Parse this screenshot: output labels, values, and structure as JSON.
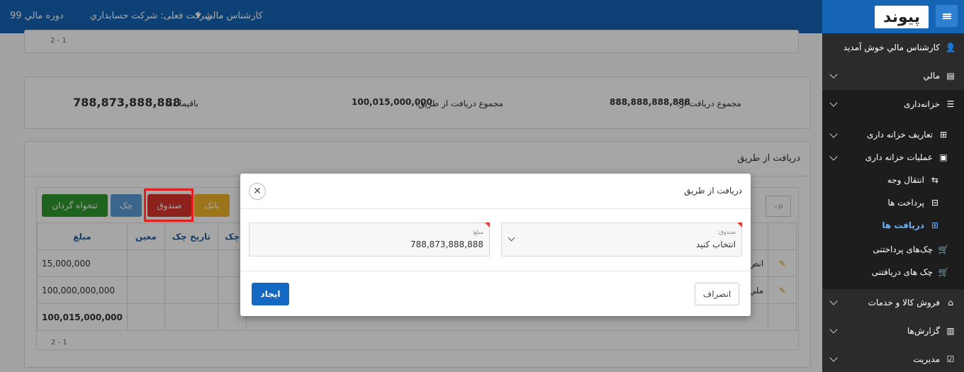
{
  "topbar": {
    "fiscal_period": "دوره مالي 99",
    "company": "شرکت فعلی: شرکت حسابداري",
    "user_menu": "کارشناس مالي",
    "logo_text": "پیوند"
  },
  "sidebar": {
    "welcome": "کارشناس مالي خوش آمديد",
    "items": [
      {
        "label": "مالي",
        "icon": "calculator-icon"
      },
      {
        "label": "خزانه‌داری",
        "icon": "checklist-icon"
      },
      {
        "label": "تعاریف خزانه داری",
        "icon": "grid-icon"
      },
      {
        "label": "عملیات خزانه داری",
        "icon": "money-icon"
      },
      {
        "label": "انتقال وجه",
        "icon": "transfer-icon"
      },
      {
        "label": "پرداخت ها",
        "icon": "minus-box-icon"
      },
      {
        "label": "دریافت ها",
        "icon": "plus-box-icon"
      },
      {
        "label": "چک‌های پرداختنی",
        "icon": "cart-out-icon"
      },
      {
        "label": "چک های دریافتنی",
        "icon": "cart-in-icon"
      },
      {
        "label": "فروش کالا و خدمات",
        "icon": "basket-icon"
      },
      {
        "label": "گزارش‌ها",
        "icon": "report-icon"
      },
      {
        "label": "مدیریت",
        "icon": "checkbox-icon"
      }
    ]
  },
  "summary": {
    "received_from_label": "مجموع دریافت از:",
    "received_from_value": "888,888,888,888",
    "received_via_label": "مجموع دریافت از طریق:",
    "received_via_value": "100,015,000,000",
    "remaining_label": "باقیمانده:",
    "remaining_value": "788,873,888,888"
  },
  "pagination": "2 - 1",
  "receive_section": {
    "title": "دریافت از طریق",
    "buttons": {
      "bank": "بانک",
      "cashbox": "صندوق",
      "check": "چک",
      "petty_cash": "تنخواه گردان"
    },
    "table": {
      "headers": [
        "مبلغ",
        "معین",
        "تاریخ چک",
        "چک"
      ],
      "rows": [
        {
          "amount": "15,000,000",
          "desc": "انص"
        },
        {
          "amount": "100,000,000,000",
          "desc": "ملي"
        }
      ],
      "total": "100,015,000,000"
    }
  },
  "modal": {
    "title": "دریافت از طریق",
    "cashbox_label": "صندوق:",
    "cashbox_value": "انتخاب کنید",
    "amount_label": "مبلغ:",
    "amount_value": "788,873,888,888",
    "cancel": "انصراف",
    "create": "ایجاد"
  }
}
